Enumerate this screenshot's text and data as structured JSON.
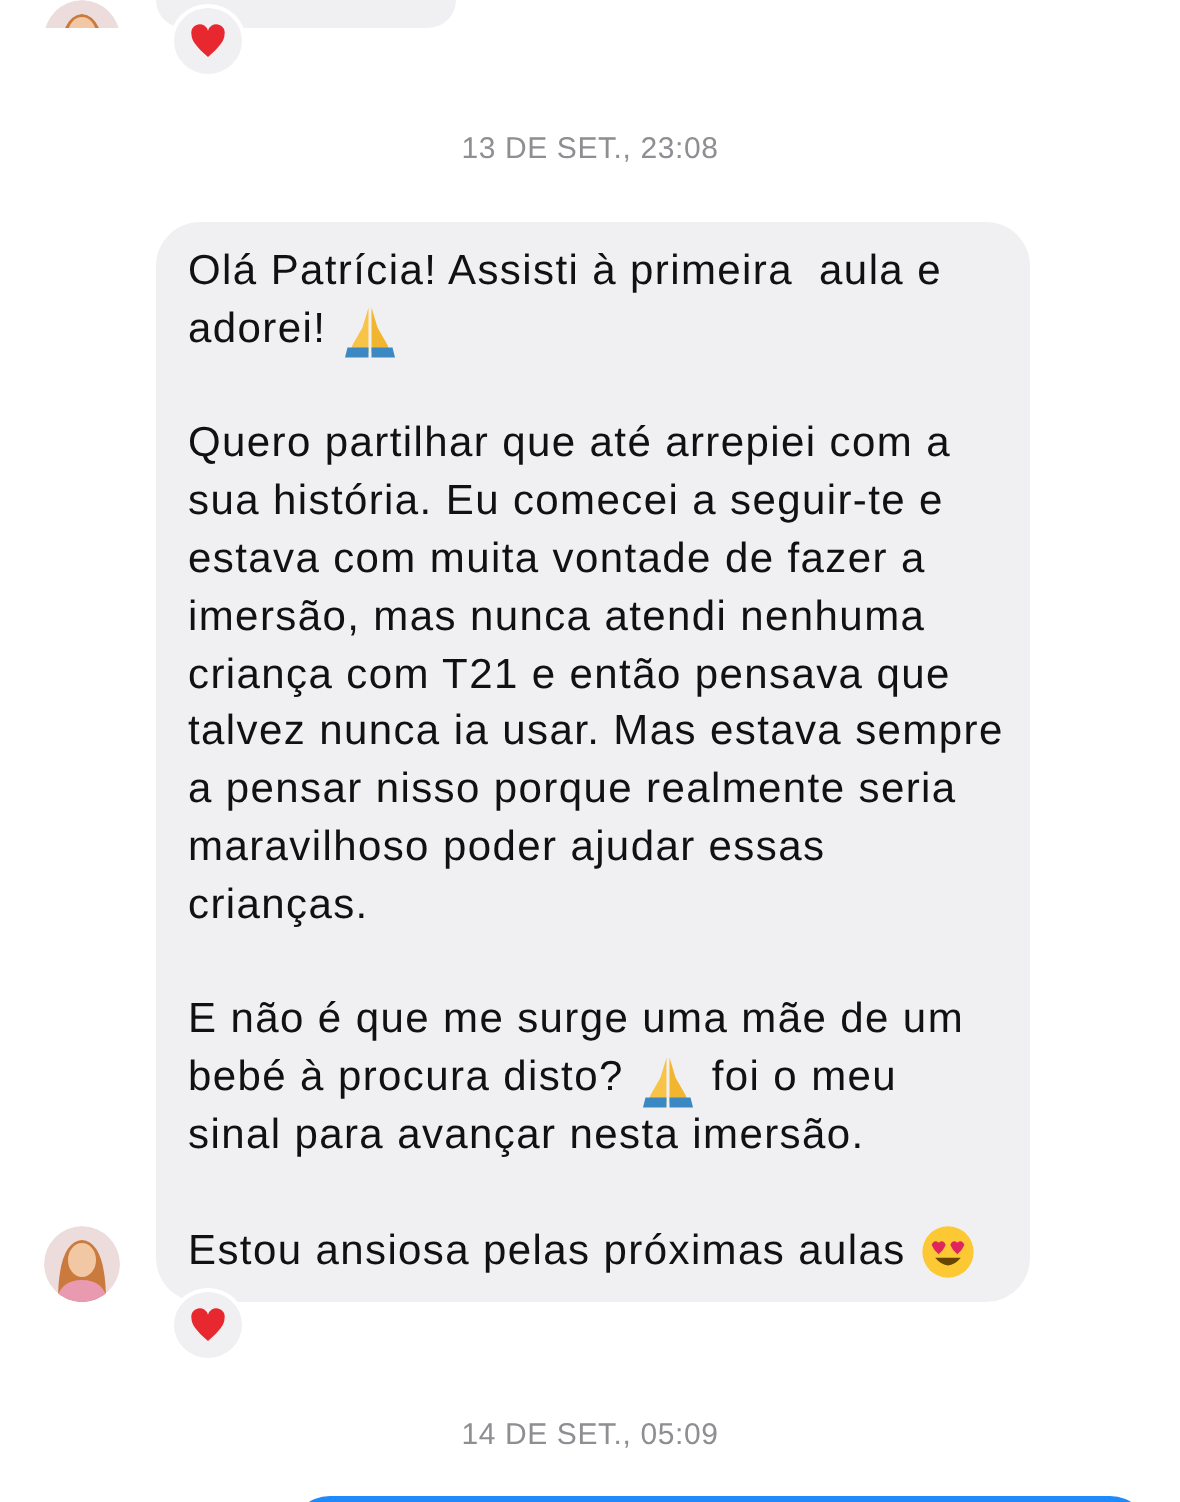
{
  "messages": [
    {
      "kind": "received",
      "reaction": {
        "kind": "heart"
      }
    },
    {
      "kind": "timestamp",
      "text": "13 DE SET., 23:08"
    },
    {
      "kind": "received",
      "paragraphs": [
        {
          "lines": [
            [
              {
                "text": "Olá Patrícia! Assisti à primeira  aula e"
              }
            ],
            [
              {
                "text": "adorei!"
              },
              {
                "kind": "pray-emoji"
              }
            ]
          ]
        },
        {
          "lines": [
            [
              {
                "text": "Quero partilhar que até arrepiei com a"
              }
            ],
            [
              {
                "text": "sua história. Eu comecei a seguir-te e"
              }
            ],
            [
              {
                "text": "estava com muita vontade de fazer a"
              }
            ],
            [
              {
                "text": "imersão, mas nunca atendi nenhuma"
              }
            ],
            [
              {
                "text": "criança com T21 e então pensava que"
              }
            ],
            [
              {
                "text": "talvez nunca ia usar. Mas estava sempre"
              }
            ],
            [
              {
                "text": "a pensar nisso porque realmente seria"
              }
            ],
            [
              {
                "text": "maravilhoso poder ajudar essas"
              }
            ],
            [
              {
                "text": "crianças."
              }
            ]
          ]
        },
        {
          "lines": [
            [
              {
                "text": "E não é que me surge uma mãe de um"
              }
            ],
            [
              {
                "text": "bebé à procura disto?"
              },
              {
                "kind": "pray-emoji"
              },
              {
                "text": "foi o meu"
              }
            ],
            [
              {
                "text": "sinal para avançar nesta imersão."
              }
            ]
          ]
        },
        {
          "lines": [
            [
              {
                "text": "Estou ansiosa pelas próximas aulas"
              },
              {
                "kind": "heart-eyes-emoji"
              }
            ]
          ]
        }
      ],
      "reaction": {
        "kind": "heart"
      }
    },
    {
      "kind": "timestamp",
      "text": "14 DE SET., 05:09"
    },
    {
      "kind": "sent"
    }
  ]
}
